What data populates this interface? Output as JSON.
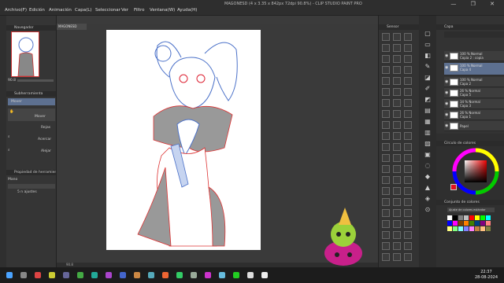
{
  "window": {
    "title": "MAGONESD (4 x 3.35 x 842px 72dpi 90.8%) - CLIP STUDIO PAINT PRO",
    "controls": "— ❐ ✕"
  },
  "menu": [
    "Archivo(F)",
    "Edición",
    "Animación",
    "Capa(L)",
    "Seleccionar",
    "Ver",
    "Filtro",
    "Ventana(W)",
    "Ayuda(H)"
  ],
  "left_panel": {
    "navigator_label": "Navegador",
    "tool_property_label": "Subherramienta",
    "zoom_value": "90.8",
    "tool_items": [
      "Mover",
      "Mover",
      "Rejas",
      "Acercar",
      "Alejar"
    ],
    "tool_prop_header": "Propiedad de herramienta",
    "tool_prop_name": "Mano",
    "tool_prop_value": "5 n ajustes"
  },
  "canvas": {
    "doc_tab": "MAGONESD",
    "status": "90.8"
  },
  "materials": {
    "header": "Sensor"
  },
  "layers": {
    "header": "Capa",
    "items": [
      {
        "line1": "100 % Normal",
        "line2": "Copia 2 : copia"
      },
      {
        "line1": "100 % Normal",
        "line2": "Capa 4"
      },
      {
        "line1": "100 % Normal",
        "line2": "Capa 2"
      },
      {
        "line1": "26 % Normal",
        "line2": "Capa 5"
      },
      {
        "line1": "34 % Normal",
        "line2": "Capa 3"
      },
      {
        "line1": "26 % Normal",
        "line2": "Capa 1"
      },
      {
        "line1": "",
        "line2": "Papel"
      }
    ]
  },
  "color_panel": {
    "header": "Círculo de colores"
  },
  "color_set": {
    "header": "Conjunto de colores",
    "select": "Ajuste de colores estándar",
    "swatches": [
      "#ffffff",
      "#000000",
      "#808080",
      "#c0c0c0",
      "#ff0000",
      "#ffff00",
      "#00ff00",
      "#00ffff",
      "#0000ff",
      "#ff00ff",
      "#804000",
      "#ff8000",
      "#408000",
      "#004080",
      "#800080",
      "#ff8080",
      "#ffff80",
      "#80ff80",
      "#80ffff",
      "#8080ff",
      "#ff80ff",
      "#c08040",
      "#ffc080",
      "#808040"
    ]
  },
  "taskbar": {
    "time": "22:37",
    "date": "28-08-2024"
  }
}
